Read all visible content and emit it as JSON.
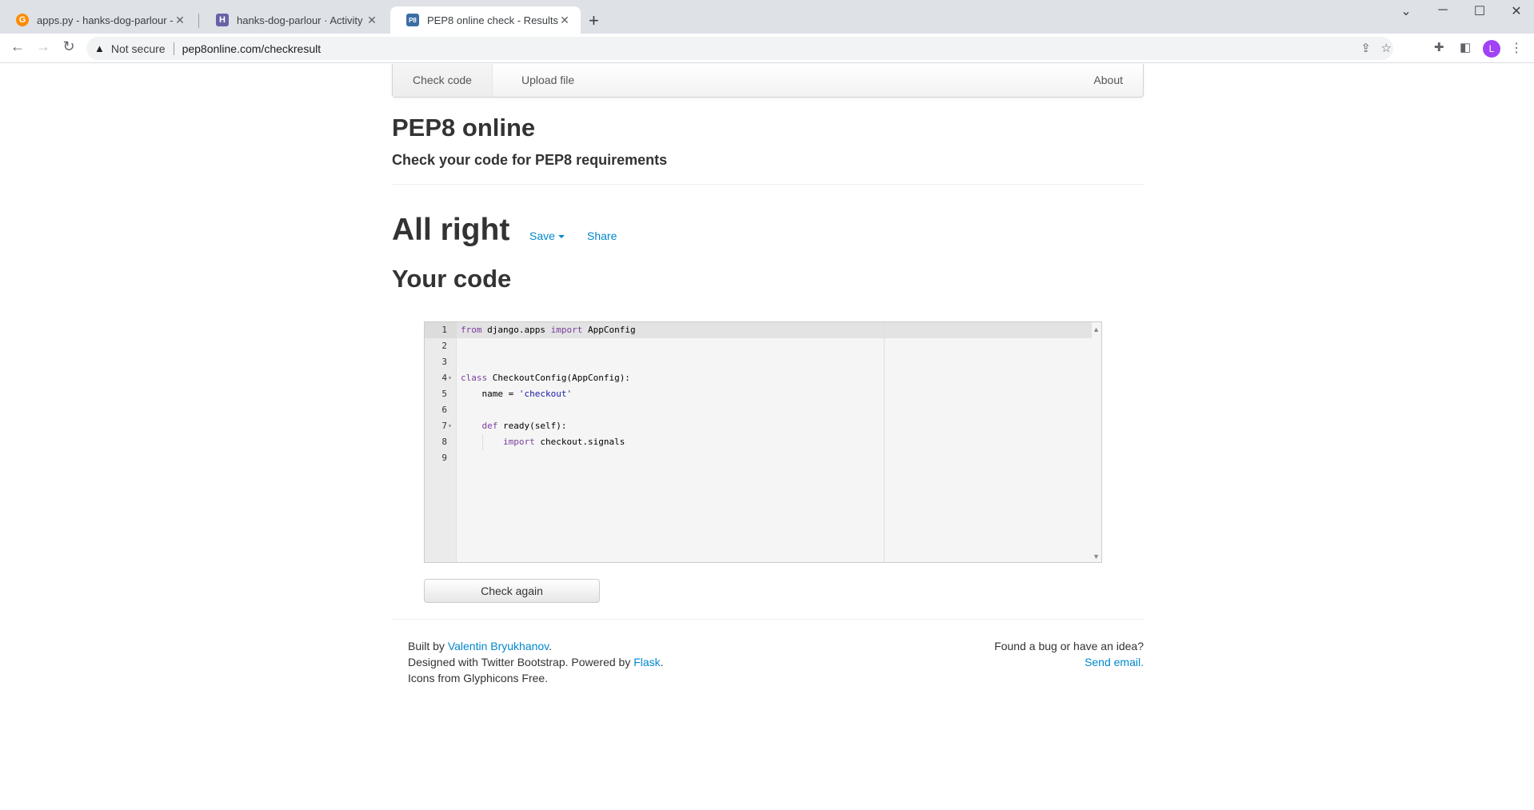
{
  "browser": {
    "tabs": [
      {
        "title": "apps.py - hanks-dog-parlour - Gi",
        "favicon": "gitpod-icon",
        "favicon_color": "#ff8a00"
      },
      {
        "title": "hanks-dog-parlour · Activity | He",
        "favicon": "heroku-icon",
        "favicon_color": "#6762a6"
      },
      {
        "title": "PEP8 online check - Results",
        "favicon": "pep8-icon",
        "favicon_color": "#3b6ea5"
      }
    ],
    "new_tab": "+",
    "security_label": "Not secure",
    "url": "pep8online.com/checkresult",
    "profile_initial": "L"
  },
  "nav": {
    "check_code": "Check code",
    "upload_file": "Upload file",
    "about": "About"
  },
  "header": {
    "title": "PEP8 online",
    "subtitle": "Check your code for PEP8 requirements"
  },
  "result": {
    "title": "All right",
    "save_label": "Save",
    "share_label": "Share",
    "code_title": "Your code"
  },
  "editor": {
    "lines": [
      {
        "n": "1",
        "code": "from django.apps import AppConfig"
      },
      {
        "n": "2",
        "code": ""
      },
      {
        "n": "3",
        "code": ""
      },
      {
        "n": "4",
        "code": "class CheckoutConfig(AppConfig):"
      },
      {
        "n": "5",
        "code": "    name = 'checkout'"
      },
      {
        "n": "6",
        "code": ""
      },
      {
        "n": "7",
        "code": "    def ready(self):"
      },
      {
        "n": "8",
        "code": "        import checkout.signals"
      },
      {
        "n": "9",
        "code": ""
      }
    ]
  },
  "check_again_label": "Check again",
  "footer": {
    "built_by_prefix": "Built by ",
    "author": "Valentin Bryukhanov",
    "designed_prefix": "Designed with Twitter Bootstrap. Powered by ",
    "flask": "Flask",
    "icons": "Icons from Glyphicons Free.",
    "bug_text": "Found a bug or have an idea?",
    "send_email": "Send email."
  },
  "colors": {
    "link": "#0088cc",
    "keyword": "#9933ff",
    "string": "#1a1aa6"
  }
}
